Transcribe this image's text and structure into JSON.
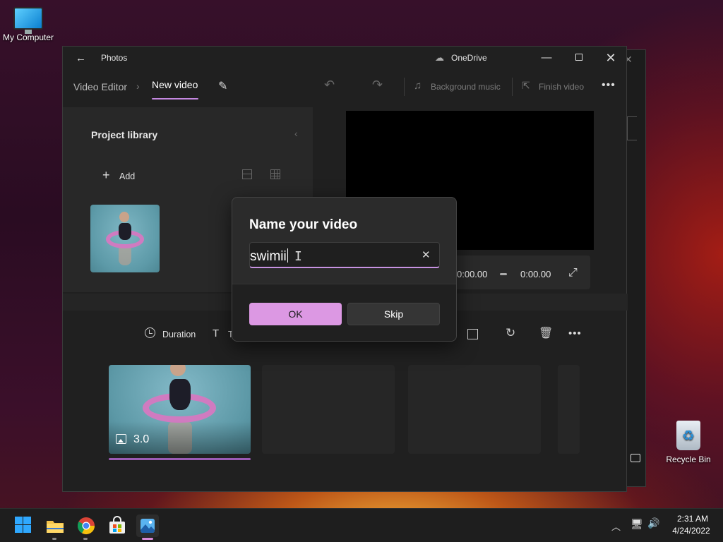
{
  "desktop": {
    "icons": [
      {
        "label": "My Computer"
      },
      {
        "label": "Recycle Bin"
      }
    ]
  },
  "window": {
    "title": "Photos",
    "cloud_label": "OneDrive",
    "breadcrumb": {
      "parent": "Video Editor",
      "current": "New video"
    },
    "toolbar": {
      "background_music": "Background music",
      "finish_video": "Finish video"
    }
  },
  "library": {
    "title": "Project library",
    "add_label": "Add"
  },
  "preview": {
    "current_time": "0:00.00",
    "total_time": "0:00.00"
  },
  "storyboard": {
    "tools": {
      "duration": "Duration",
      "text_partial": "T"
    },
    "clips": [
      {
        "duration": "3.0",
        "type": "image"
      }
    ]
  },
  "dialog": {
    "title": "Name your video",
    "input_value": "swimii",
    "ok_label": "OK",
    "skip_label": "Skip"
  },
  "taskbar": {
    "time": "2:31 AM",
    "date": "4/24/2022",
    "apps": [
      "start",
      "file-explorer",
      "chrome",
      "microsoft-store",
      "photos"
    ]
  },
  "colors": {
    "accent": "#dc98e3",
    "accent_underline": "#c488e0",
    "clip_progress": "#9b5bb5"
  }
}
